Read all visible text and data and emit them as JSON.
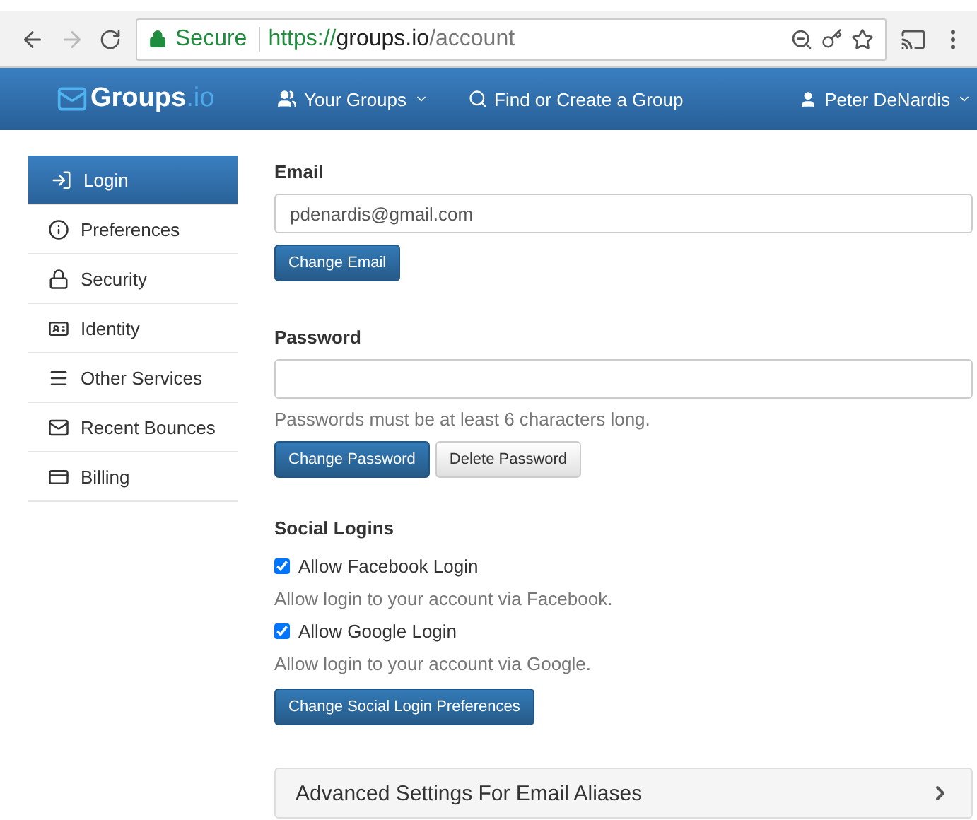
{
  "browser": {
    "secure_label": "Secure",
    "url_scheme": "https://",
    "url_host": "groups.io",
    "url_path": "/account"
  },
  "navbar": {
    "logo": "Groups",
    "logo_suffix": ".io",
    "items": [
      {
        "kind": "groups",
        "label": "Your Groups",
        "dropdown": true
      },
      {
        "kind": "search",
        "label": "Find or Create a Group",
        "dropdown": false
      }
    ],
    "user": "Peter DeNardis"
  },
  "sidebar": {
    "items": [
      {
        "kind": "login",
        "label": "Login",
        "selected": true
      },
      {
        "kind": "info",
        "label": "Preferences",
        "selected": false
      },
      {
        "kind": "lock",
        "label": "Security",
        "selected": false
      },
      {
        "kind": "id",
        "label": "Identity",
        "selected": false
      },
      {
        "kind": "bars",
        "label": "Other Services",
        "selected": false
      },
      {
        "kind": "mail",
        "label": "Recent Bounces",
        "selected": false
      },
      {
        "kind": "card",
        "label": "Billing",
        "selected": false
      }
    ]
  },
  "email": {
    "label": "Email",
    "value": "pdenardis@gmail.com",
    "button": "Change Email"
  },
  "password": {
    "label": "Password",
    "hint": "Passwords must be at least 6 characters long.",
    "buttons": [
      {
        "label": "Change Password",
        "primary": true
      },
      {
        "label": "Delete Password",
        "primary": false
      }
    ]
  },
  "social": {
    "title": "Social Logins",
    "options": [
      {
        "label": "Allow Facebook Login",
        "checked": true,
        "help": "Allow login to your account via Facebook."
      },
      {
        "label": "Allow Google Login",
        "checked": true,
        "help": "Allow login to your account via Google."
      }
    ],
    "button": "Change Social Login Preferences"
  },
  "advanced": {
    "label": "Advanced Settings For Email Aliases"
  }
}
